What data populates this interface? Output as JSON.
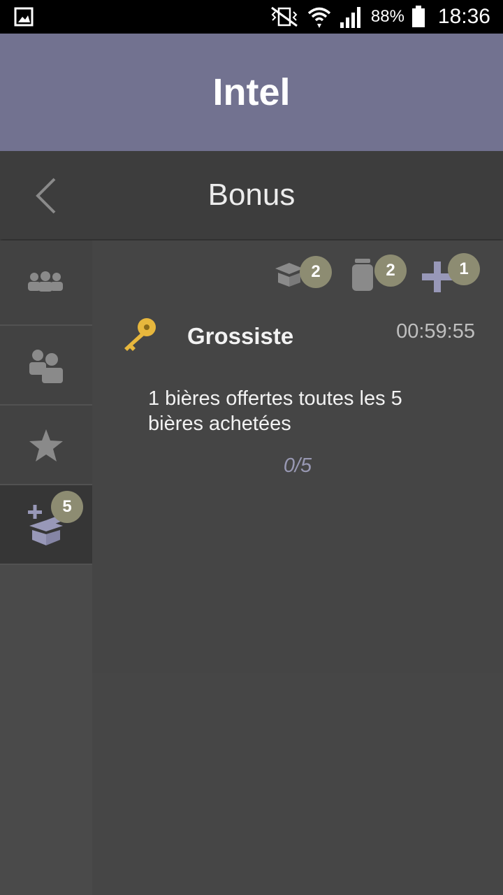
{
  "status_bar": {
    "battery": "88%",
    "time": "18:36"
  },
  "header": {
    "title": "Intel"
  },
  "nav": {
    "title": "Bonus"
  },
  "sidebar": {
    "tabs": [
      {
        "icon": "group-icon"
      },
      {
        "icon": "contacts-icon"
      },
      {
        "icon": "star-icon"
      },
      {
        "icon": "box-plus-icon",
        "badge": "5"
      }
    ]
  },
  "toolbar": {
    "items": [
      {
        "icon": "open-box-icon",
        "badge": "2"
      },
      {
        "icon": "jar-icon",
        "badge": "2"
      },
      {
        "icon": "plus-icon",
        "badge": "1"
      }
    ]
  },
  "bonus": {
    "name": "Grossiste",
    "timer": "00:59:55",
    "description": "1 bières offertes toutes les 5 bières achetées",
    "progress": "0/5"
  },
  "colors": {
    "header_bg": "#727290",
    "accent": "#9898b8",
    "badge": "#8d8c72",
    "key": "#e7b73d"
  }
}
